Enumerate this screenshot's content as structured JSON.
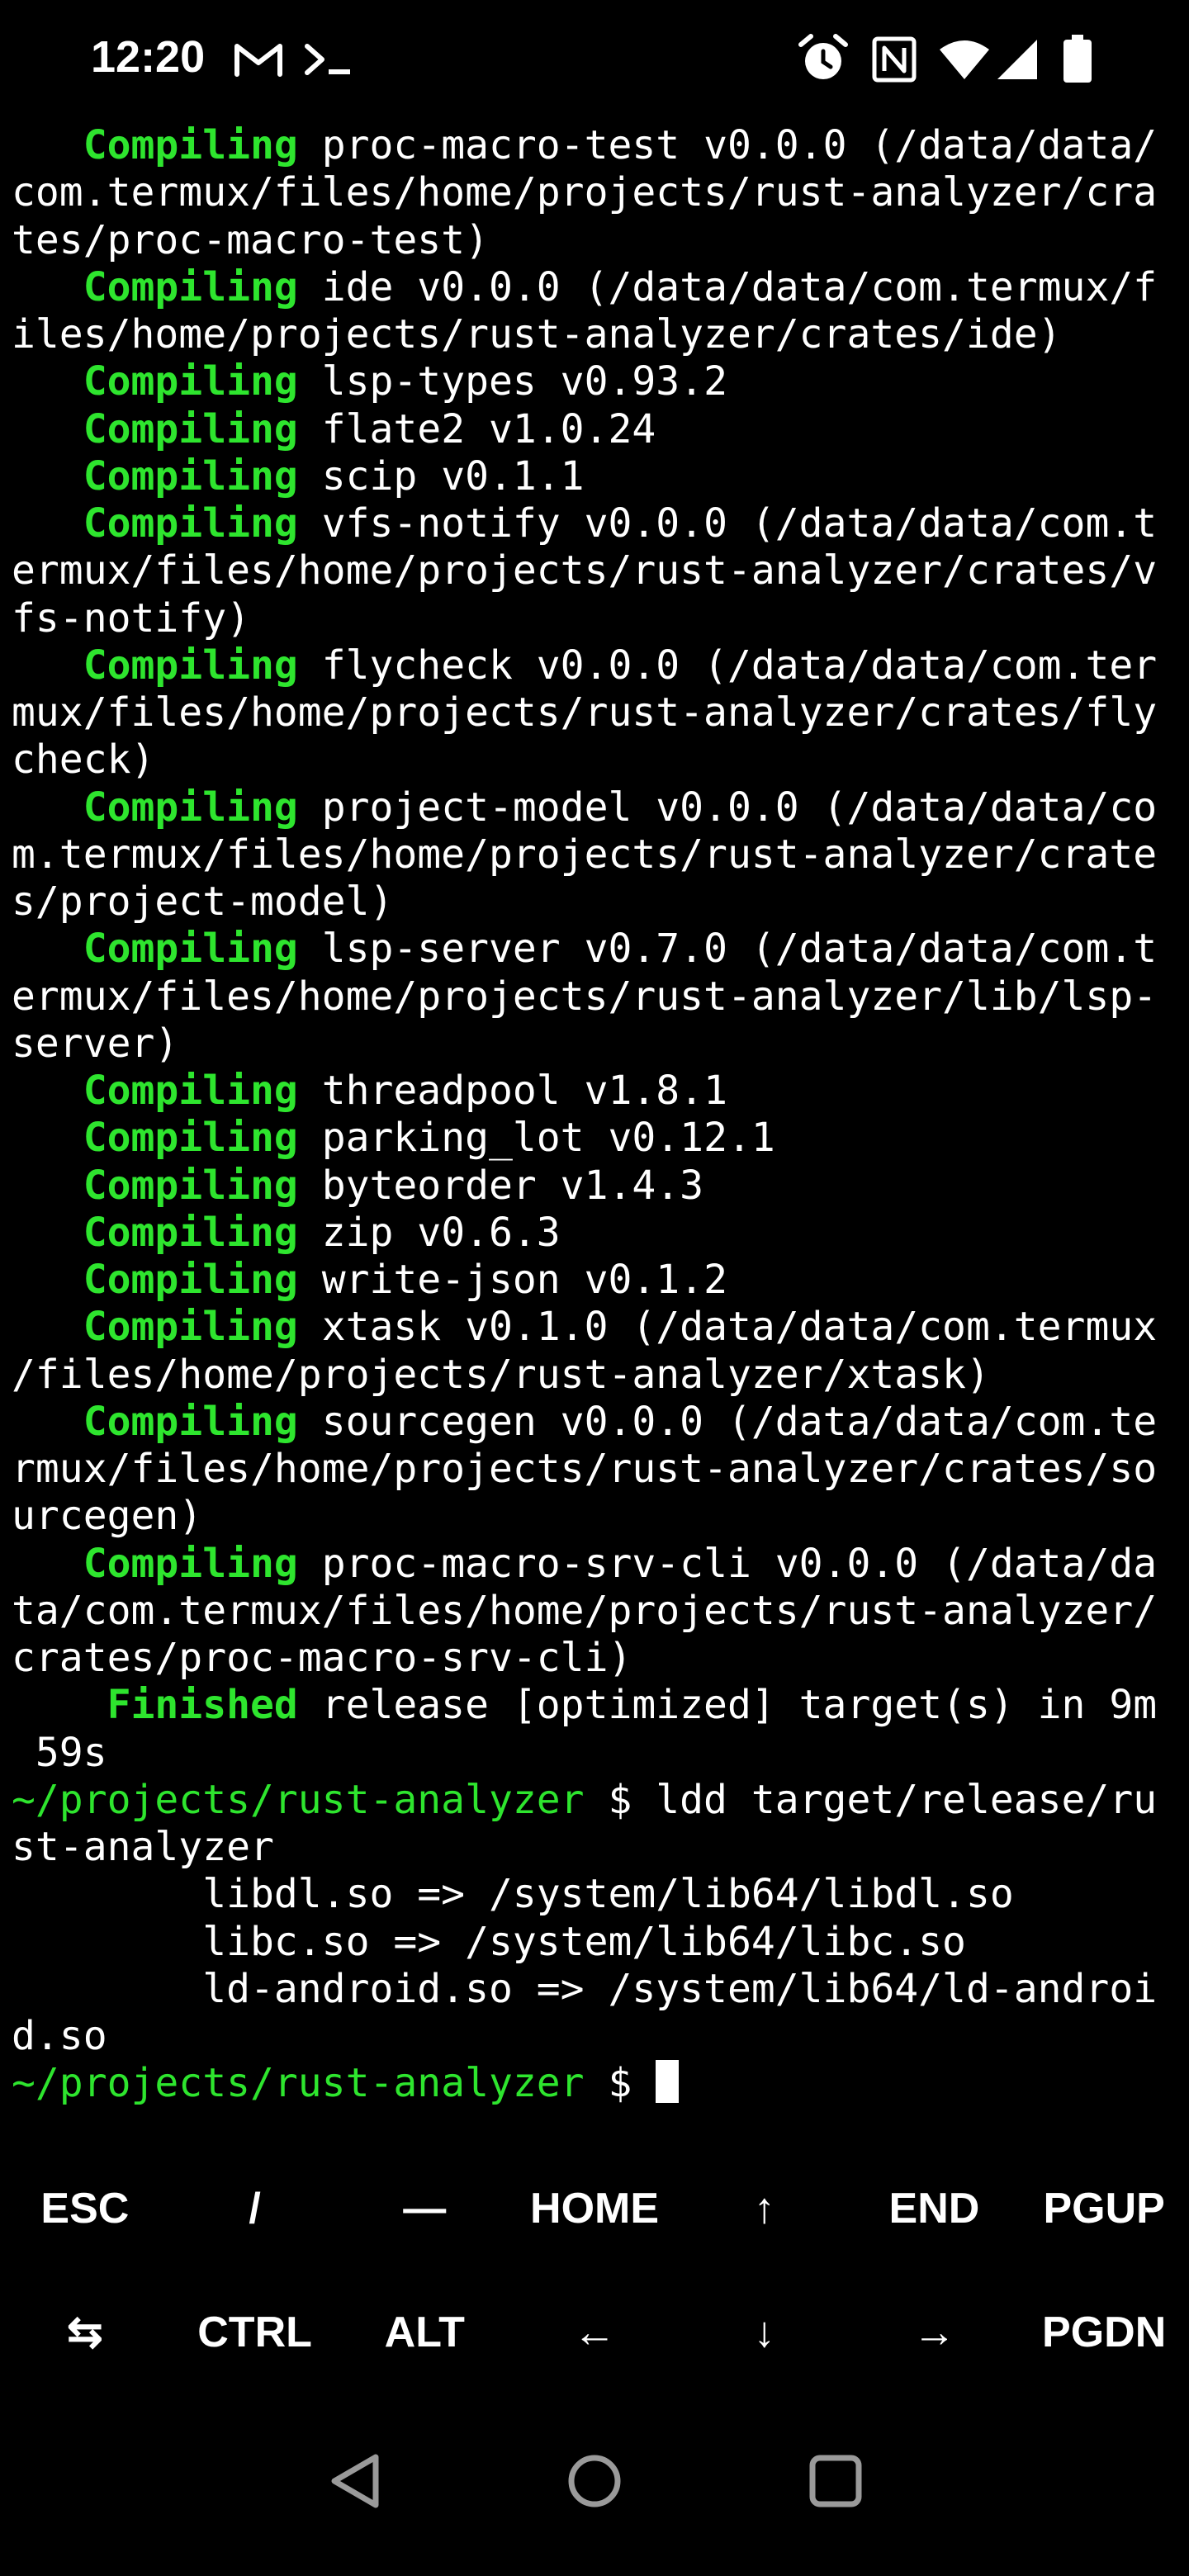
{
  "status_bar": {
    "time": "12:20",
    "left_icons": [
      "gmail-icon",
      "terminal-prompt-icon"
    ],
    "right_icons": [
      "alarm-icon",
      "nfc-icon",
      "wifi-icon",
      "cellular-signal-icon",
      "battery-icon"
    ]
  },
  "terminal": {
    "lines": [
      {
        "indent": "   ",
        "keyword": "Compiling",
        "text": " proc-macro-test v0.0.0 (/data/data/"
      },
      {
        "text": "com.termux/files/home/projects/rust-analyzer/cra"
      },
      {
        "text": "tes/proc-macro-test)"
      },
      {
        "indent": "   ",
        "keyword": "Compiling",
        "text": " ide v0.0.0 (/data/data/com.termux/f"
      },
      {
        "text": "iles/home/projects/rust-analyzer/crates/ide)"
      },
      {
        "indent": "   ",
        "keyword": "Compiling",
        "text": " lsp-types v0.93.2"
      },
      {
        "indent": "   ",
        "keyword": "Compiling",
        "text": " flate2 v1.0.24"
      },
      {
        "indent": "   ",
        "keyword": "Compiling",
        "text": " scip v0.1.1"
      },
      {
        "indent": "   ",
        "keyword": "Compiling",
        "text": " vfs-notify v0.0.0 (/data/data/com.t"
      },
      {
        "text": "ermux/files/home/projects/rust-analyzer/crates/v"
      },
      {
        "text": "fs-notify)"
      },
      {
        "indent": "   ",
        "keyword": "Compiling",
        "text": " flycheck v0.0.0 (/data/data/com.ter"
      },
      {
        "text": "mux/files/home/projects/rust-analyzer/crates/fly"
      },
      {
        "text": "check)"
      },
      {
        "indent": "   ",
        "keyword": "Compiling",
        "text": " project-model v0.0.0 (/data/data/co"
      },
      {
        "text": "m.termux/files/home/projects/rust-analyzer/crate"
      },
      {
        "text": "s/project-model)"
      },
      {
        "indent": "   ",
        "keyword": "Compiling",
        "text": " lsp-server v0.7.0 (/data/data/com.t"
      },
      {
        "text": "ermux/files/home/projects/rust-analyzer/lib/lsp-"
      },
      {
        "text": "server)"
      },
      {
        "indent": "   ",
        "keyword": "Compiling",
        "text": " threadpool v1.8.1"
      },
      {
        "indent": "   ",
        "keyword": "Compiling",
        "text": " parking_lot v0.12.1"
      },
      {
        "indent": "   ",
        "keyword": "Compiling",
        "text": " byteorder v1.4.3"
      },
      {
        "indent": "   ",
        "keyword": "Compiling",
        "text": " zip v0.6.3"
      },
      {
        "indent": "   ",
        "keyword": "Compiling",
        "text": " write-json v0.1.2"
      },
      {
        "indent": "   ",
        "keyword": "Compiling",
        "text": " xtask v0.1.0 (/data/data/com.termux"
      },
      {
        "text": "/files/home/projects/rust-analyzer/xtask)"
      },
      {
        "indent": "   ",
        "keyword": "Compiling",
        "text": " sourcegen v0.0.0 (/data/data/com.te"
      },
      {
        "text": "rmux/files/home/projects/rust-analyzer/crates/so"
      },
      {
        "text": "urcegen)"
      },
      {
        "indent": "   ",
        "keyword": "Compiling",
        "text": " proc-macro-srv-cli v0.0.0 (/data/da"
      },
      {
        "text": "ta/com.termux/files/home/projects/rust-analyzer/"
      },
      {
        "text": "crates/proc-macro-srv-cli)"
      },
      {
        "indent": "    ",
        "keyword": "Finished",
        "text": " release [optimized] target(s) in 9m"
      },
      {
        "text": " 59s"
      },
      {
        "path": "~/projects/rust-analyzer",
        "text": " $ ldd target/release/ru"
      },
      {
        "text": "st-analyzer"
      },
      {
        "text": "        libdl.so => /system/lib64/libdl.so"
      },
      {
        "text": "        libc.so => /system/lib64/libc.so"
      },
      {
        "text": "        ld-android.so => /system/lib64/ld-androi"
      },
      {
        "text": "d.so"
      },
      {
        "path": "~/projects/rust-analyzer",
        "text": " $ ",
        "cursor": true
      }
    ]
  },
  "extra_keys": {
    "row1": [
      {
        "label": "ESC",
        "name": "esc-key"
      },
      {
        "label": "/",
        "name": "slash-key"
      },
      {
        "label": "—",
        "name": "dash-key"
      },
      {
        "label": "HOME",
        "name": "home-key"
      },
      {
        "label": "↑",
        "name": "arrow-up-key"
      },
      {
        "label": "END",
        "name": "end-key"
      },
      {
        "label": "PGUP",
        "name": "page-up-key"
      }
    ],
    "row2": [
      {
        "label": "⇆",
        "name": "tab-key"
      },
      {
        "label": "CTRL",
        "name": "ctrl-key"
      },
      {
        "label": "ALT",
        "name": "alt-key"
      },
      {
        "label": "←",
        "name": "arrow-left-key"
      },
      {
        "label": "↓",
        "name": "arrow-down-key"
      },
      {
        "label": "→",
        "name": "arrow-right-key"
      },
      {
        "label": "PGDN",
        "name": "page-down-key"
      }
    ]
  },
  "nav_bar": {
    "buttons": [
      "back-icon",
      "home-icon",
      "recents-icon"
    ]
  },
  "colors": {
    "background": "#000000",
    "terminal_green": "#2ee52e",
    "text": "#ffffff",
    "nav_gray": "#9a9a9a"
  }
}
